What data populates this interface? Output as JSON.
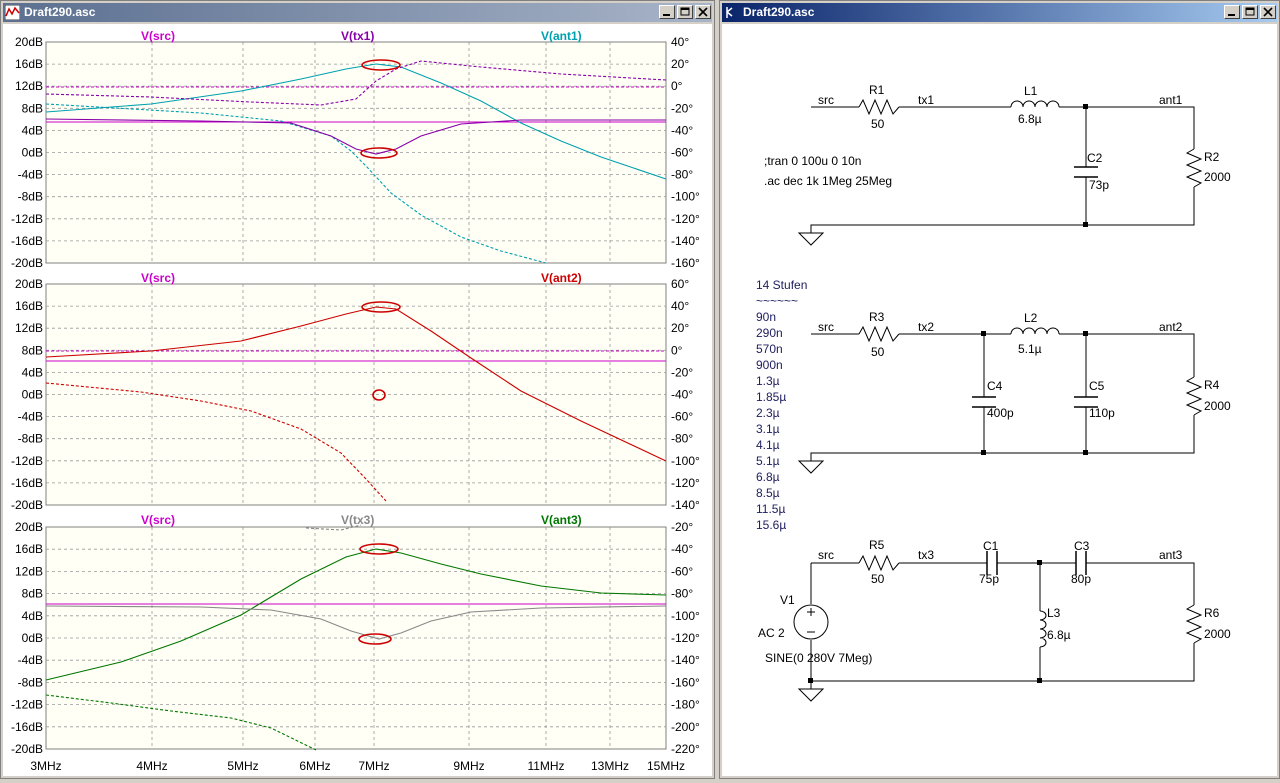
{
  "windows": {
    "plot": {
      "title": "Draft290.asc"
    },
    "schematic": {
      "title": "Draft290.asc"
    }
  },
  "colors": {
    "src": "#cc00cc",
    "tx1": "#8800aa",
    "ant1": "#00a0b0",
    "ant2": "#cc0000",
    "tx3": "#888888",
    "ant3": "#007700",
    "plot_bg": "#fffff5",
    "grid": "#999999",
    "schematic_text": "#202060"
  },
  "plot": {
    "x_ticks": [
      "3MHz",
      "4MHz",
      "5MHz",
      "6MHz",
      "7MHz",
      "9MHz",
      "11MHz",
      "13MHz",
      "15MHz"
    ],
    "panes": [
      {
        "traces": [
          "V(src)",
          "V(tx1)",
          "V(ant1)"
        ],
        "y_left": [
          "20dB",
          "16dB",
          "12dB",
          "8dB",
          "4dB",
          "0dB",
          "-4dB",
          "-8dB",
          "-12dB",
          "-16dB",
          "-20dB"
        ],
        "y_right": [
          "40°",
          "20°",
          "0°",
          "-20°",
          "-40°",
          "-60°",
          "-80°",
          "-100°",
          "-120°",
          "-140°",
          "-160°"
        ]
      },
      {
        "traces": [
          "V(src)",
          "V(ant2)"
        ],
        "y_left": [
          "20dB",
          "16dB",
          "12dB",
          "8dB",
          "4dB",
          "0dB",
          "-4dB",
          "-8dB",
          "-12dB",
          "-16dB",
          "-20dB"
        ],
        "y_right": [
          "60°",
          "40°",
          "20°",
          "0°",
          "-20°",
          "-40°",
          "-60°",
          "-80°",
          "-100°",
          "-120°",
          "-140°"
        ]
      },
      {
        "traces": [
          "V(src)",
          "V(tx3)",
          "V(ant3)"
        ],
        "y_left": [
          "20dB",
          "16dB",
          "12dB",
          "8dB",
          "4dB",
          "0dB",
          "-4dB",
          "-8dB",
          "-12dB",
          "-16dB",
          "-20dB"
        ],
        "y_right": [
          "-20°",
          "-40°",
          "-60°",
          "-80°",
          "-100°",
          "-120°",
          "-140°",
          "-160°",
          "-180°",
          "-200°",
          "-220°"
        ]
      }
    ]
  },
  "schematic": {
    "circuit1": {
      "node_src": "src",
      "node_tx": "tx1",
      "node_ant": "ant1",
      "r1_name": "R1",
      "r1_value": "50",
      "l1_name": "L1",
      "l1_value": "6.8µ",
      "c2_name": "C2",
      "c2_value": "73p",
      "r2_name": "R2",
      "r2_value": "2000",
      "directive_tran": ";tran 0 100u 0 10n",
      "directive_ac": ".ac dec 1k 1Meg 25Meg"
    },
    "circuit2": {
      "node_src": "src",
      "node_tx": "tx2",
      "node_ant": "ant2",
      "r3_name": "R3",
      "r3_value": "50",
      "l2_name": "L2",
      "l2_value": "5.1µ",
      "c4_name": "C4",
      "c4_value": "400p",
      "c5_name": "C5",
      "c5_value": "110p",
      "r4_name": "R4",
      "r4_value": "2000"
    },
    "circuit3": {
      "node_src": "src",
      "node_tx": "tx3",
      "node_ant": "ant3",
      "r5_name": "R5",
      "r5_value": "50",
      "c1_name": "C1",
      "c1_value": "75p",
      "c3_name": "C3",
      "c3_value": "80p",
      "l3_name": "L3",
      "l3_value": "6.8µ",
      "r6_name": "R6",
      "r6_value": "2000",
      "v1_name": "V1",
      "v1_ac": "AC 2",
      "v1_sine": "SINE(0 280V 7Meg)"
    },
    "notes": {
      "heading": "14 Stufen",
      "underline": "~~~~~~",
      "values": [
        "90n",
        "290n",
        "570n",
        "900n",
        "1.3µ",
        "1.85µ",
        "2.3µ",
        "3.1µ",
        "4.1µ",
        "5.1µ",
        "6.8µ",
        "8.5µ",
        "11.5µ",
        "15.6µ"
      ]
    }
  }
}
